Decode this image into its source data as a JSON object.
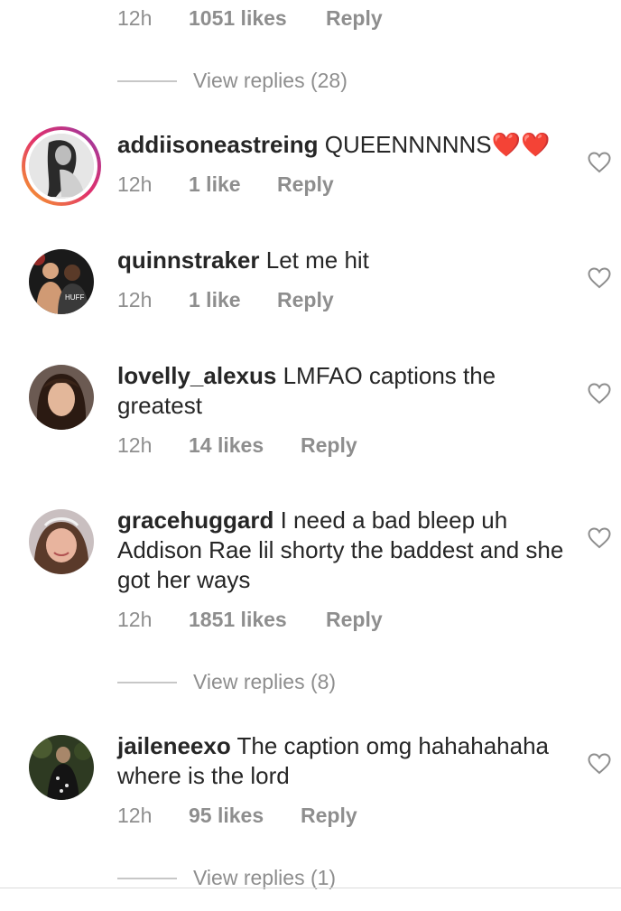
{
  "top_meta": {
    "time": "12h",
    "likes": "1051 likes",
    "reply": "Reply"
  },
  "top_view_replies": "View replies (28)",
  "comments": [
    {
      "username": "addiisoneastreing",
      "text": "QUEENNNNNS",
      "emoji": "❤️❤️",
      "time": "12h",
      "likes": "1 like",
      "reply": "Reply",
      "story_ring": true
    },
    {
      "username": "quinnstraker",
      "text": "Let me hit",
      "time": "12h",
      "likes": "1 like",
      "reply": "Reply"
    },
    {
      "username": "lovelly_alexus",
      "text": "LMFAO captions the greatest",
      "time": "12h",
      "likes": "14 likes",
      "reply": "Reply"
    },
    {
      "username": "gracehuggard",
      "text": "I need a bad bleep uh Addison Rae lil shorty the baddest and she got her ways",
      "time": "12h",
      "likes": "1851 likes",
      "reply": "Reply",
      "view_replies": "View replies (8)"
    },
    {
      "username": "jaileneexo",
      "text": "The caption omg hahahahaha where is the lord",
      "time": "12h",
      "likes": "95 likes",
      "reply": "Reply",
      "view_replies": "View replies (1)"
    }
  ],
  "colors": {
    "text": "#262626",
    "secondary": "#8e8e8e",
    "heart_red": "#e0162b",
    "divider": "#c7c7c7"
  }
}
